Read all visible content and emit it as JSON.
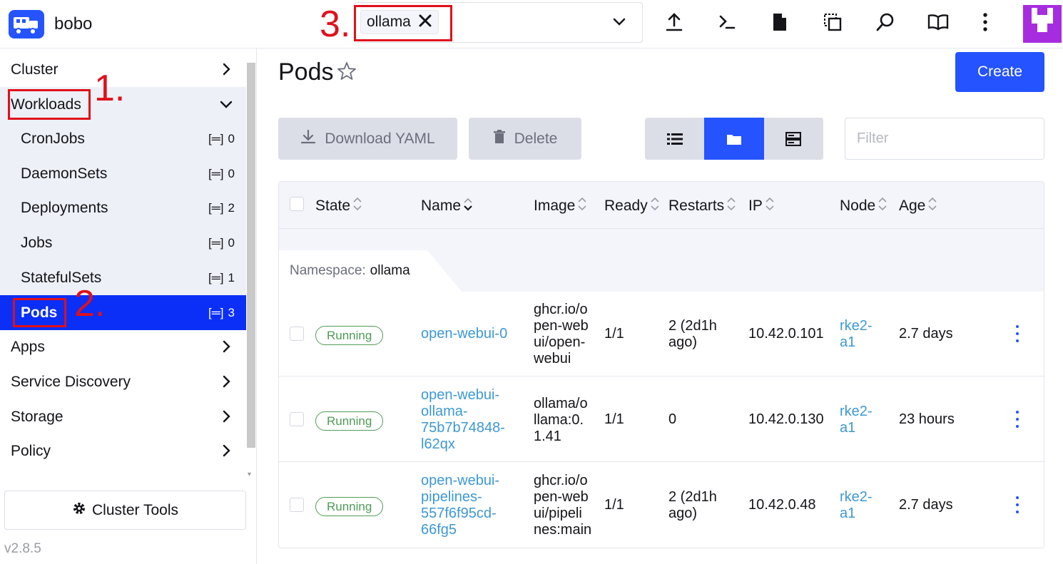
{
  "header": {
    "cluster_name": "bobo",
    "namespace_chip": "ollama",
    "icons": [
      "upload-icon",
      "terminal-icon",
      "file-icon",
      "copy-config-icon",
      "search-icon",
      "book-icon",
      "more-vertical-icon"
    ]
  },
  "annotations": {
    "one": "1.",
    "two": "2.",
    "three": "3."
  },
  "sidebar": {
    "groups": [
      {
        "label": "Cluster"
      },
      {
        "label": "Workloads"
      },
      {
        "label": "Apps"
      },
      {
        "label": "Service Discovery"
      },
      {
        "label": "Storage"
      },
      {
        "label": "Policy"
      }
    ],
    "workloads": [
      {
        "label": "CronJobs",
        "count": "0"
      },
      {
        "label": "DaemonSets",
        "count": "0"
      },
      {
        "label": "Deployments",
        "count": "2"
      },
      {
        "label": "Jobs",
        "count": "0"
      },
      {
        "label": "StatefulSets",
        "count": "1"
      },
      {
        "label": "Pods",
        "count": "3"
      }
    ],
    "tools_label": "Cluster Tools",
    "version": "v2.8.5"
  },
  "main": {
    "title": "Pods",
    "create_label": "Create",
    "download_label": "Download YAML",
    "delete_label": "Delete",
    "filter_placeholder": "Filter",
    "columns": [
      "State",
      "Name",
      "Image",
      "Ready",
      "Restarts",
      "IP",
      "Node",
      "Age"
    ],
    "namespace_label": "Namespace:",
    "namespace_value": "ollama",
    "rows": [
      {
        "state": "Running",
        "name": [
          "open-webui-0"
        ],
        "image": [
          "ghcr.io/o",
          "pen-web",
          "ui/open-",
          "webui"
        ],
        "ready": "1/1",
        "restarts": [
          "2 (2d1h",
          "ago)"
        ],
        "ip": "10.42.0.101",
        "node": [
          "rke2-",
          "a1"
        ],
        "age": "2.7 days"
      },
      {
        "state": "Running",
        "name": [
          "open-webui-",
          "ollama-",
          "75b7b74848-",
          "l62qx"
        ],
        "image": [
          "ollama/o",
          "llama:0.",
          "1.41"
        ],
        "ready": "1/1",
        "restarts": [
          "0"
        ],
        "ip": "10.42.0.130",
        "node": [
          "rke2-",
          "a1"
        ],
        "age": "23 hours"
      },
      {
        "state": "Running",
        "name": [
          "open-webui-",
          "pipelines-",
          "557f6f95cd-",
          "66fg5"
        ],
        "image": [
          "ghcr.io/o",
          "pen-web",
          "ui/pipeli",
          "nes:main"
        ],
        "ready": "1/1",
        "restarts": [
          "2 (2d1h",
          "ago)"
        ],
        "ip": "10.42.0.48",
        "node": [
          "rke2-",
          "a1"
        ],
        "age": "2.7 days"
      }
    ]
  },
  "colors": {
    "accent": "#2453ff",
    "active_nav": "#0b2ff7",
    "link": "#3d98d3",
    "success": "#4e9c55",
    "annotation": "#e0101a",
    "avatar": "#a72ce0"
  }
}
